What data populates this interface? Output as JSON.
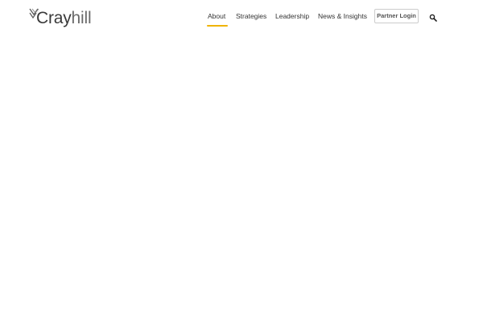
{
  "brand": {
    "name_primary": "Cray",
    "name_secondary": "hill",
    "logo_icon": "chevron-mark-icon",
    "logo_color": "#5a5a5a"
  },
  "nav": {
    "items": [
      {
        "label": "About",
        "active": true
      },
      {
        "label": "Strategies",
        "active": false
      },
      {
        "label": "Leadership",
        "active": false
      },
      {
        "label": "News & Insights",
        "active": false
      }
    ],
    "accent_color": "#f0b400"
  },
  "header": {
    "partner_login_label": "Partner Login",
    "search_icon": "search-icon"
  }
}
